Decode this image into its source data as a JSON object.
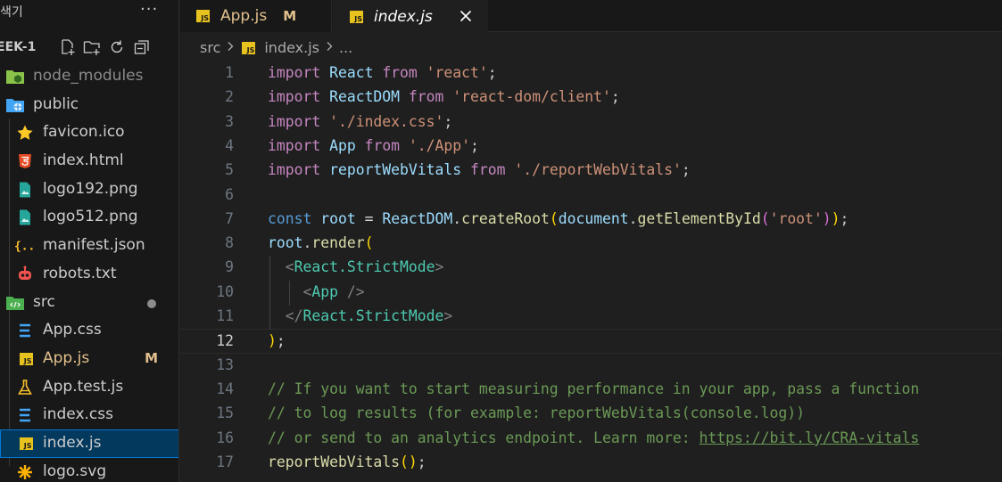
{
  "sidebar": {
    "title": "색기",
    "more_label": "···",
    "section_title": "EEK-1",
    "items": [
      {
        "label": "node_modules",
        "icon": "node-folder-icon",
        "indent": 0
      },
      {
        "label": "public",
        "icon": "public-folder-icon",
        "indent": 0
      },
      {
        "label": "favicon.ico",
        "icon": "star-icon",
        "indent": 1
      },
      {
        "label": "index.html",
        "icon": "html5-icon",
        "indent": 1
      },
      {
        "label": "logo192.png",
        "icon": "image-icon",
        "indent": 1
      },
      {
        "label": "logo512.png",
        "icon": "image-icon",
        "indent": 1
      },
      {
        "label": "manifest.json",
        "icon": "json-icon",
        "indent": 1
      },
      {
        "label": "robots.txt",
        "icon": "robot-icon",
        "indent": 1
      },
      {
        "label": "src",
        "icon": "src-folder-icon",
        "indent": 0
      },
      {
        "label": "App.css",
        "icon": "css3-icon",
        "indent": 1
      },
      {
        "label": "App.js",
        "icon": "js-file-icon",
        "indent": 1,
        "badge": "M"
      },
      {
        "label": "App.test.js",
        "icon": "flask-icon",
        "indent": 1
      },
      {
        "label": "index.css",
        "icon": "css3-icon",
        "indent": 1
      },
      {
        "label": "index.js",
        "icon": "js-file-icon",
        "indent": 1
      },
      {
        "label": "logo.svg",
        "icon": "react-logo-icon",
        "indent": 1
      }
    ]
  },
  "tabs": [
    {
      "label": "App.js",
      "badge": "M",
      "icon": "js-file-icon"
    },
    {
      "label": "index.js",
      "icon": "js-file-icon",
      "active": true
    }
  ],
  "js_badge_text": "JS",
  "breadcrumb": {
    "folder": "src",
    "file": "index.js",
    "tail": "..."
  },
  "editor": {
    "current_line": 12,
    "line_numbers": [
      "1",
      "2",
      "3",
      "4",
      "5",
      "6",
      "7",
      "8",
      "9",
      "10",
      "11",
      "12",
      "13",
      "14",
      "15",
      "16",
      "17"
    ]
  },
  "colors": {
    "sidebar_bg": "#181818",
    "editor_bg": "#1f1f1f",
    "selection": "#04395e",
    "focus_border": "#0078d4",
    "modified": "#e2c08d",
    "js_yellow": "#e8c21e"
  }
}
